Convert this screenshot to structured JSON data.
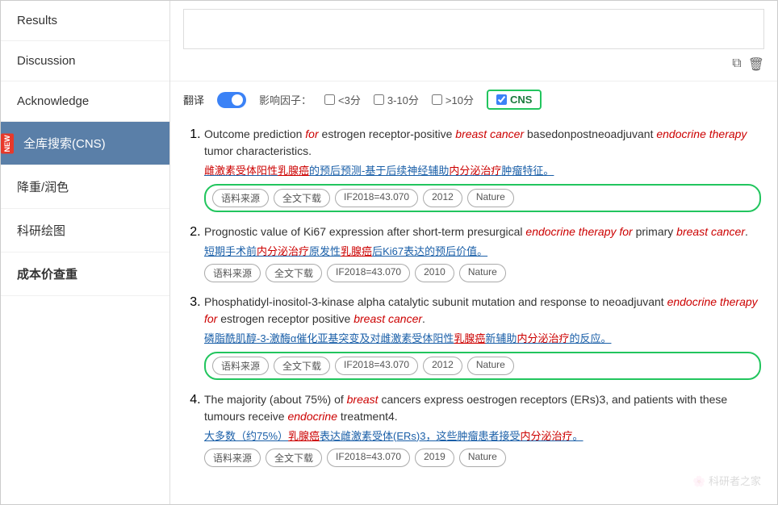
{
  "sidebar": {
    "items": [
      {
        "label": "Results",
        "active": false
      },
      {
        "label": "Discussion",
        "active": false
      },
      {
        "label": "Acknowledge",
        "active": false
      },
      {
        "label": "全库搜索(CNS)",
        "active": true,
        "new": true
      },
      {
        "label": "降重/润色",
        "active": false
      },
      {
        "label": "科研绘图",
        "active": false
      },
      {
        "label": "成本价查重",
        "active": false
      }
    ]
  },
  "toolbar": {
    "copy_icon": "⧉",
    "delete_icon": "🗑"
  },
  "filter": {
    "translate_label": "翻译",
    "impact_label": "影响因子：",
    "option1": "<3分",
    "option2": "3-10分",
    "option3": ">10分",
    "cns_label": "CNS"
  },
  "results": [
    {
      "id": 1,
      "title_parts": [
        {
          "text": "Outcome prediction ",
          "style": "normal"
        },
        {
          "text": "for",
          "style": "red-italic"
        },
        {
          "text": " estrogen receptor-positive ",
          "style": "normal"
        },
        {
          "text": "breast cancer",
          "style": "red-italic"
        },
        {
          "text": " basedonpostneoadjuvant ",
          "style": "normal"
        },
        {
          "text": "endocrine therapy",
          "style": "red-italic"
        },
        {
          "text": " tumor characteristics.",
          "style": "normal"
        }
      ],
      "translation_parts": [
        {
          "text": "雌激素受体阳性",
          "style": "red"
        },
        {
          "text": "乳腺癌",
          "style": "red-underline"
        },
        {
          "text": "的预后预测-基于后续神经辅助",
          "style": "blue"
        },
        {
          "text": "内分泌治疗",
          "style": "red"
        },
        {
          "text": "肿瘤特征。",
          "style": "blue"
        }
      ],
      "tags": [
        "语料来源",
        "全文下载",
        "IF2018=43.070",
        "2012",
        "Nature"
      ],
      "tag_border": true
    },
    {
      "id": 2,
      "title_parts": [
        {
          "text": "Prognostic value of Ki67 expression after short-term presurgical ",
          "style": "normal"
        },
        {
          "text": "endocrine therapy for",
          "style": "red-italic"
        },
        {
          "text": " primary ",
          "style": "normal"
        },
        {
          "text": "breast cancer",
          "style": "red-italic"
        },
        {
          "text": ".",
          "style": "normal"
        }
      ],
      "translation": "短期手术前内分泌治疗原发性乳腺癌后Ki67表达的预后价值。",
      "translation_parts": [
        {
          "text": "短期手术前",
          "style": "blue"
        },
        {
          "text": "内分泌治疗",
          "style": "red"
        },
        {
          "text": "原发性",
          "style": "blue"
        },
        {
          "text": "乳腺癌",
          "style": "red-underline"
        },
        {
          "text": "后Ki67表达的预后价值。",
          "style": "blue"
        }
      ],
      "tags": [
        "语料来源",
        "全文下载",
        "IF2018=43.070",
        "2010",
        "Nature"
      ],
      "tag_border": false
    },
    {
      "id": 3,
      "title_parts": [
        {
          "text": "Phosphatidyl-inositol-3-kinase alpha catalytic subunit mutation and response to neoadjuvant ",
          "style": "normal"
        },
        {
          "text": "endocrine therapy for",
          "style": "red-italic"
        },
        {
          "text": " estrogen receptor positive ",
          "style": "normal"
        },
        {
          "text": "breast cancer",
          "style": "red-italic"
        },
        {
          "text": ".",
          "style": "normal"
        }
      ],
      "translation_parts": [
        {
          "text": "磷脂酰肌醇-3-激酶α催化亚基突变及对雌激素受体阳性",
          "style": "blue"
        },
        {
          "text": "乳腺癌",
          "style": "red-underline"
        },
        {
          "text": "新辅助",
          "style": "blue"
        },
        {
          "text": "内分泌治疗",
          "style": "red"
        },
        {
          "text": "的反应。",
          "style": "blue"
        }
      ],
      "tags": [
        "语料来源",
        "全文下载",
        "IF2018=43.070",
        "2012",
        "Nature"
      ],
      "tag_border": true
    },
    {
      "id": 4,
      "title_parts": [
        {
          "text": "The majority (about 75%) of ",
          "style": "normal"
        },
        {
          "text": "breast",
          "style": "red-italic"
        },
        {
          "text": " cancers express oestrogen receptors (ERs)3, and patients with these tumours receive ",
          "style": "normal"
        },
        {
          "text": "endocrine",
          "style": "red-italic"
        },
        {
          "text": " treatment4.",
          "style": "normal"
        }
      ],
      "translation_parts": [
        {
          "text": "大多数（约75%）",
          "style": "blue"
        },
        {
          "text": "乳腺癌",
          "style": "red-underline"
        },
        {
          "text": "表达雌激素受体(ERs)3，这些肿瘤患者接受",
          "style": "blue"
        },
        {
          "text": "内分泌治疗",
          "style": "red"
        },
        {
          "text": "。",
          "style": "blue"
        }
      ],
      "tags": [
        "语料来源",
        "全文下载",
        "IF2018=43.070",
        "2019",
        "Nature"
      ],
      "tag_border": false
    }
  ],
  "watermark": "科研者之家"
}
